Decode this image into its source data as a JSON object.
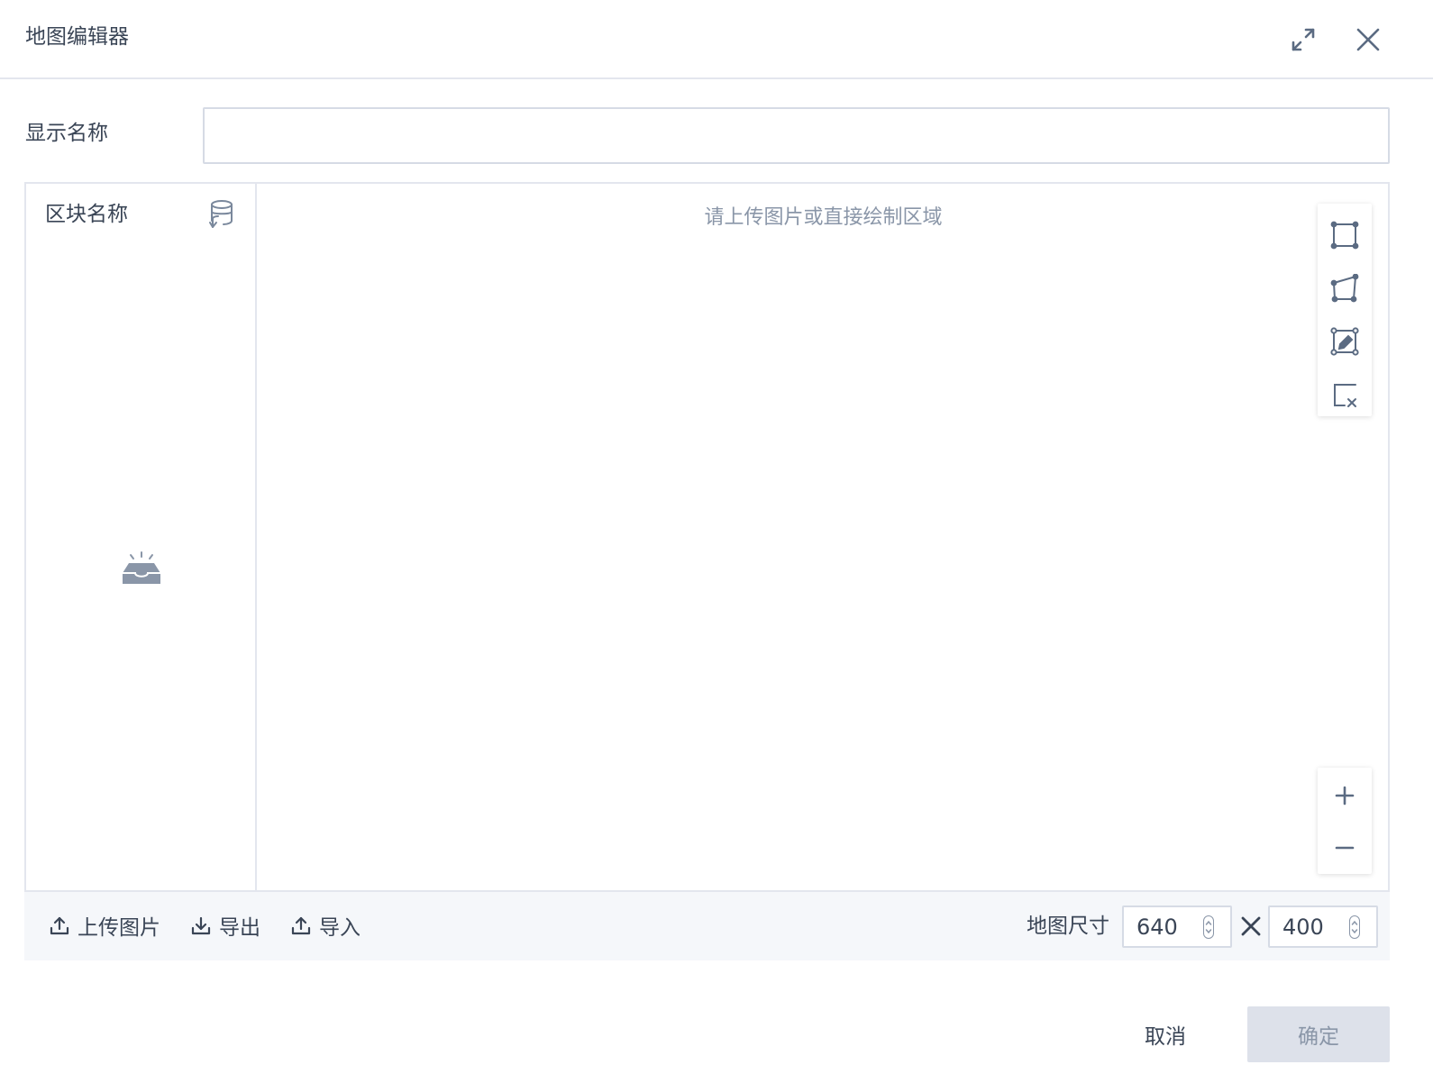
{
  "dialog": {
    "title": "地图编辑器"
  },
  "form": {
    "display_name_label": "显示名称",
    "display_name_value": "",
    "display_name_placeholder": ""
  },
  "block_panel": {
    "title": "区块名称"
  },
  "canvas": {
    "hint": "请上传图片或直接绘制区域"
  },
  "bottom_bar": {
    "upload_label": "上传图片",
    "export_label": "导出",
    "import_label": "导入",
    "size_label": "地图尺寸",
    "width_value": "640",
    "height_value": "400"
  },
  "footer": {
    "cancel_label": "取消",
    "ok_label": "确定"
  },
  "icons": {
    "expand": "expand-icon",
    "close": "close-icon",
    "database": "database-sync-icon",
    "empty": "empty-inbox-icon",
    "rectangle": "draw-rectangle-icon",
    "polygon": "draw-polygon-icon",
    "edit": "edit-shape-icon",
    "delete": "delete-shape-icon",
    "zoom_in": "zoom-in-icon",
    "zoom_out": "zoom-out-icon",
    "upload": "upload-icon",
    "export": "download-icon",
    "import": "upload-icon",
    "times": "times-icon"
  },
  "colors": {
    "text": "#3a4556",
    "muted": "#8a96a8",
    "border": "#e3e6ee",
    "bar_bg": "#f5f7fa",
    "disabled_button_bg": "#dde1ea"
  }
}
